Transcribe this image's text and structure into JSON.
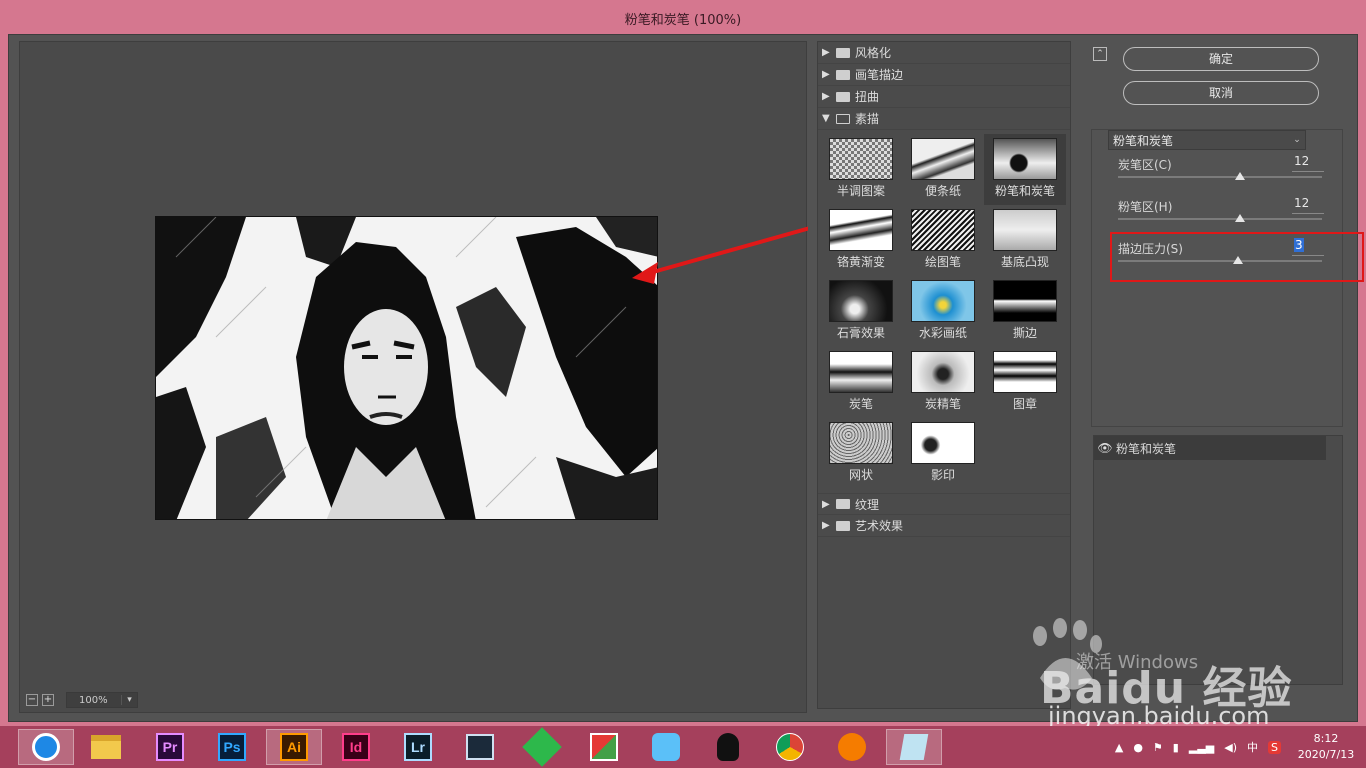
{
  "window": {
    "title": "粉笔和炭笔 (100%)"
  },
  "preview": {
    "zoom": "100%"
  },
  "gallery": {
    "folders_top": [
      {
        "label": "风格化",
        "expanded": false
      },
      {
        "label": "画笔描边",
        "expanded": false
      },
      {
        "label": "扭曲",
        "expanded": false
      },
      {
        "label": "素描",
        "expanded": true
      }
    ],
    "thumbs": [
      {
        "label": "半调图案",
        "selected": false
      },
      {
        "label": "便条纸",
        "selected": false
      },
      {
        "label": "粉笔和炭笔",
        "selected": true
      },
      {
        "label": "铬黄渐变",
        "selected": false
      },
      {
        "label": "绘图笔",
        "selected": false
      },
      {
        "label": "基底凸现",
        "selected": false
      },
      {
        "label": "石膏效果",
        "selected": false
      },
      {
        "label": "水彩画纸",
        "selected": false
      },
      {
        "label": "撕边",
        "selected": false
      },
      {
        "label": "炭笔",
        "selected": false
      },
      {
        "label": "炭精笔",
        "selected": false
      },
      {
        "label": "图章",
        "selected": false
      },
      {
        "label": "网状",
        "selected": false
      },
      {
        "label": "影印",
        "selected": false
      }
    ],
    "folders_bottom": [
      {
        "label": "纹理",
        "expanded": false
      },
      {
        "label": "艺术效果",
        "expanded": false
      }
    ]
  },
  "settings": {
    "ok_label": "确定",
    "cancel_label": "取消",
    "filter_name": "粉笔和炭笔",
    "params": [
      {
        "label": "炭笔区(C)",
        "value": "12",
        "fraction": 0.6
      },
      {
        "label": "粉笔区(H)",
        "value": "12",
        "fraction": 0.6
      },
      {
        "label": "描边压力(S)",
        "value": "3",
        "fraction": 0.59
      }
    ]
  },
  "layers": {
    "items": [
      {
        "label": "粉笔和炭笔"
      }
    ]
  },
  "watermark": {
    "activate": "激活 Windows",
    "baidu": "Baidu 经验",
    "url": "jingyan.baidu.com"
  },
  "taskbar": {
    "apps": [
      "Pr",
      "Ps",
      "Ai",
      "Id",
      "Lr"
    ],
    "active_app": "Ai",
    "ime": "中",
    "time": "8:12",
    "date": "2020/7/13"
  },
  "colors": {
    "accent_red": "#e01818",
    "title_bar": "#d5778f",
    "taskbar": "#a5405c"
  }
}
